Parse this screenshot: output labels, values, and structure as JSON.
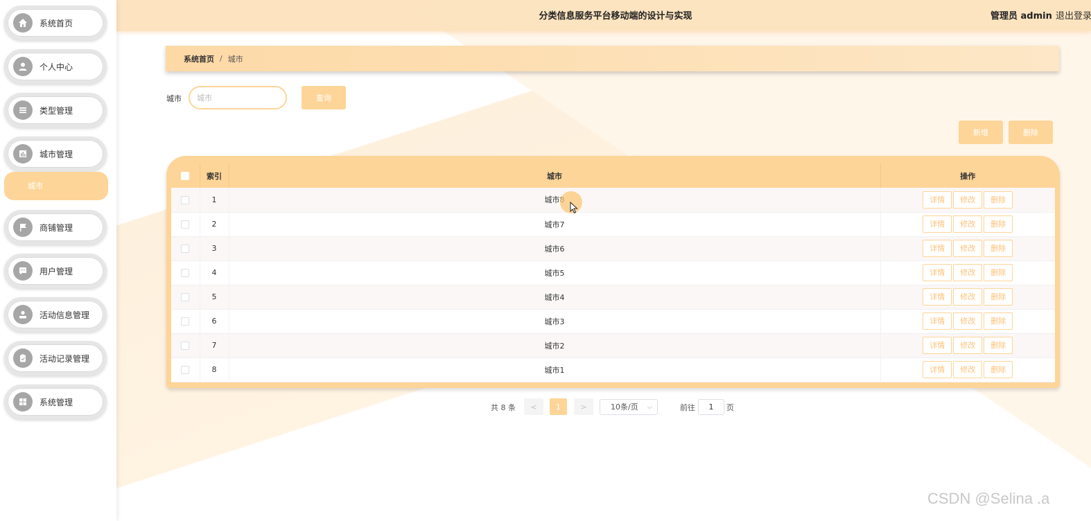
{
  "header": {
    "title": "分类信息服务平台移动端的设计与实现",
    "role": "管理员 admin",
    "logout": "退出登录"
  },
  "sidebar": {
    "items": [
      {
        "label": "系统首页",
        "icon": "home-icon"
      },
      {
        "label": "个人中心",
        "icon": "user-icon"
      },
      {
        "label": "类型管理",
        "icon": "list-icon"
      },
      {
        "label": "城市管理",
        "icon": "chart-icon"
      },
      {
        "label": "商铺管理",
        "icon": "flag-icon"
      },
      {
        "label": "用户管理",
        "icon": "chat-icon"
      },
      {
        "label": "活动信息管理",
        "icon": "person-icon"
      },
      {
        "label": "活动记录管理",
        "icon": "clipboard-icon"
      },
      {
        "label": "系统管理",
        "icon": "grid-icon"
      }
    ],
    "submenu_active": "城市"
  },
  "breadcrumb": {
    "home": "系统首页",
    "separator": "/",
    "current": "城市"
  },
  "search": {
    "label": "城市",
    "placeholder": "城市",
    "button": "查询"
  },
  "actions": {
    "add": "新增",
    "delete": "删除"
  },
  "table": {
    "headers": {
      "index": "索引",
      "city": "城市",
      "ops": "操作"
    },
    "rows": [
      {
        "index": "1",
        "city": "城市8"
      },
      {
        "index": "2",
        "city": "城市7"
      },
      {
        "index": "3",
        "city": "城市6"
      },
      {
        "index": "4",
        "city": "城市5"
      },
      {
        "index": "5",
        "city": "城市4"
      },
      {
        "index": "6",
        "city": "城市3"
      },
      {
        "index": "7",
        "city": "城市2"
      },
      {
        "index": "8",
        "city": "城市1"
      }
    ],
    "op_labels": {
      "detail": "详情",
      "edit": "修改",
      "delete": "删除"
    }
  },
  "pagination": {
    "total": "共 8 条",
    "prev": "<",
    "current": "1",
    "next": ">",
    "page_size": "10条/页",
    "goto_label": "前往",
    "goto_value": "1",
    "page_suffix": "页"
  },
  "watermark": "CSDN @Selina .a",
  "colors": {
    "accent": "#fdd598",
    "header": "#fde3bf"
  }
}
